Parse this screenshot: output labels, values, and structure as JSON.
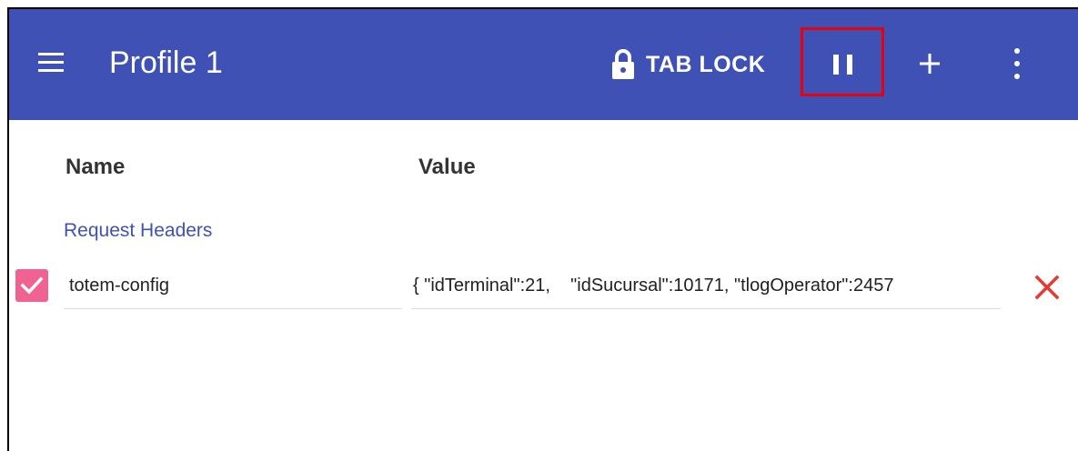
{
  "app_bar": {
    "title": "Profile 1",
    "tab_lock_label": "TAB LOCK",
    "icons": [
      "menu-icon",
      "lock-icon",
      "pause-icon",
      "plus-icon",
      "more-vert-icon"
    ],
    "background_color": "#3f51b5",
    "pause_highlight_color": "#e8000b"
  },
  "columns": {
    "name": "Name",
    "value": "Value"
  },
  "section": {
    "label": "Request Headers",
    "color": "#3f51b5"
  },
  "headers": [
    {
      "enabled": true,
      "name": "totem-config",
      "value": "{ \"idTerminal\":21,    \"idSucursal\":10171, \"tlogOperator\":2457"
    }
  ],
  "colors": {
    "checkbox": "#f06292",
    "delete": "#e53935"
  }
}
